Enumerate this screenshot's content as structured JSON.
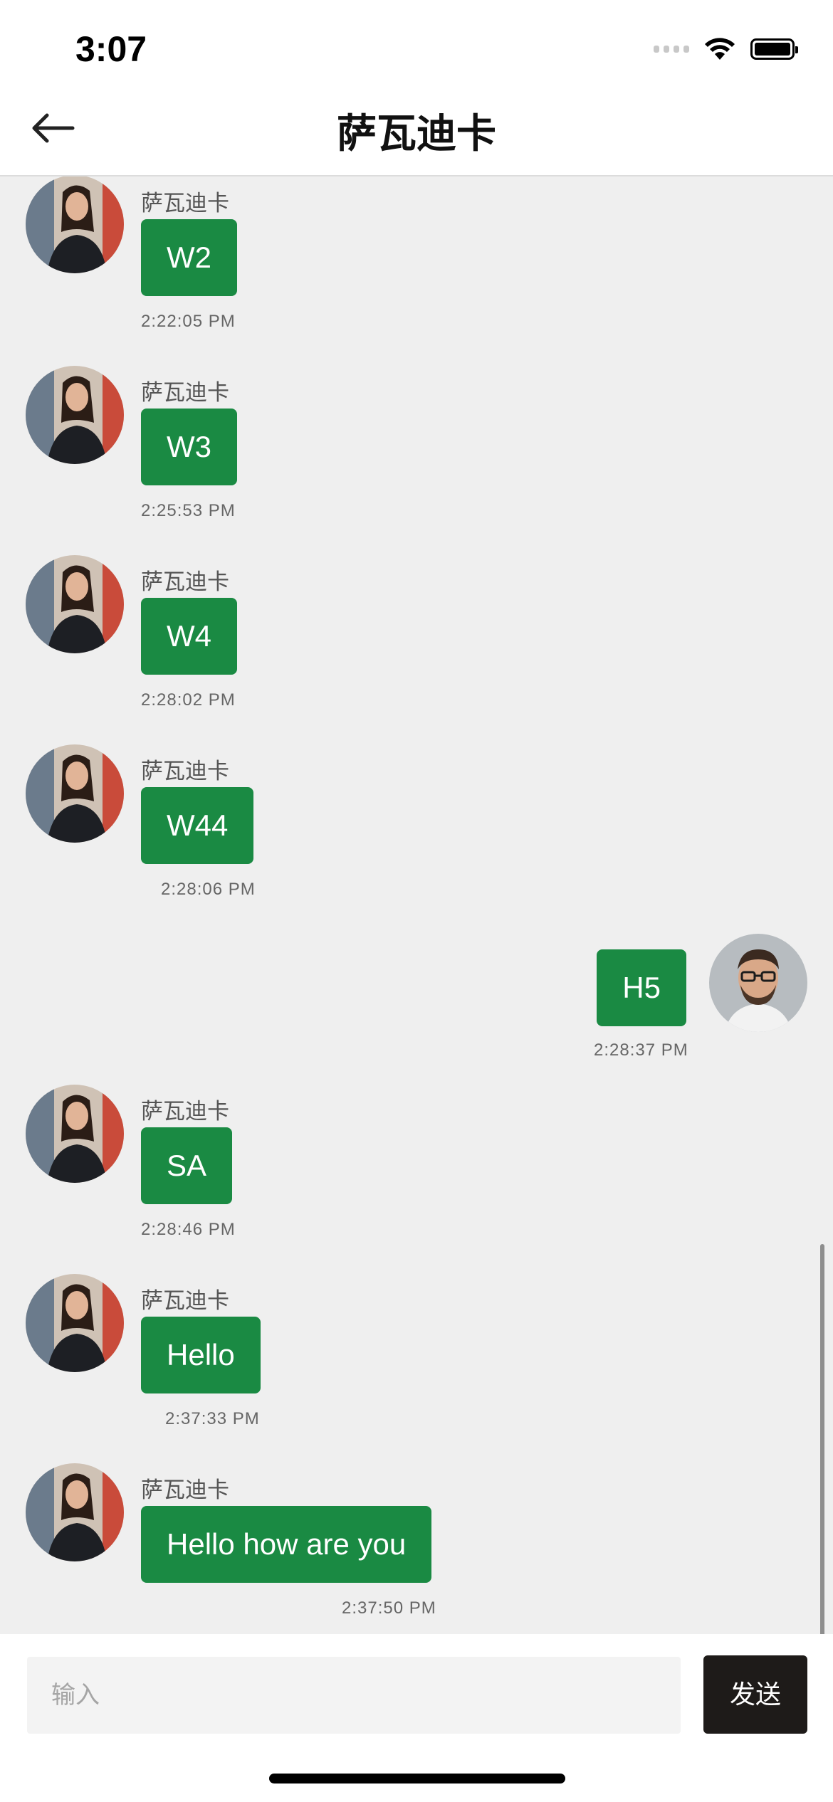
{
  "status_bar": {
    "time": "3:07"
  },
  "header": {
    "title": "萨瓦迪卡"
  },
  "messages": [
    {
      "sender": "萨瓦迪卡",
      "text": "W2",
      "time": "2:22:05 PM"
    },
    {
      "sender": "萨瓦迪卡",
      "text": "W3",
      "time": "2:25:53 PM"
    },
    {
      "sender": "萨瓦迪卡",
      "text": "W4",
      "time": "2:28:02 PM"
    },
    {
      "sender": "萨瓦迪卡",
      "text": "W44",
      "time": "2:28:06 PM"
    },
    {
      "sender": "",
      "text": "H5",
      "time": "2:28:37 PM"
    },
    {
      "sender": "萨瓦迪卡",
      "text": "SA",
      "time": "2:28:46 PM"
    },
    {
      "sender": "萨瓦迪卡",
      "text": "Hello",
      "time": "2:37:33 PM"
    },
    {
      "sender": "萨瓦迪卡",
      "text": "Hello how are you",
      "time": "2:37:50 PM"
    }
  ],
  "composer": {
    "placeholder": "输入",
    "send_label": "发送"
  },
  "colors": {
    "bubble": "#1a8a43",
    "send_button": "#1e1b19",
    "background": "#efefef"
  }
}
